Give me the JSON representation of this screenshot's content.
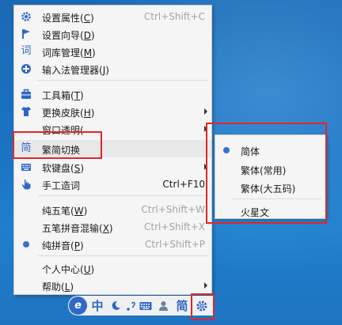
{
  "main_menu": {
    "items": [
      {
        "label": "设置属性(",
        "key": "C",
        "end": ")",
        "shortcut": "Ctrl+Shift+C",
        "icon": "gear-icon"
      },
      {
        "label": "设置向导(",
        "key": "D",
        "end": ")",
        "icon": "flag-icon"
      },
      {
        "label": "词库管理(",
        "key": "M",
        "end": ")",
        "icon": "dictionary-icon",
        "icon_text": "词"
      },
      {
        "label": "输入法管理器(",
        "key": "J",
        "end": ")",
        "icon": "ime-manager-icon"
      },
      {
        "label": "工具箱(",
        "key": "T",
        "end": ")",
        "icon": "toolbox-icon"
      },
      {
        "label": "更换皮肤(",
        "key": "H",
        "end": ")",
        "icon": "shirt-icon"
      },
      {
        "label": "窗口透明(",
        "key": "",
        "end": "",
        "icon": "transparency-icon"
      },
      {
        "label": "繁简切换",
        "key": "",
        "end": "",
        "icon": "simplified-traditional-icon",
        "icon_text": "简"
      },
      {
        "label": "软键盘(",
        "key": "S",
        "end": ")",
        "icon": "keyboard-icon"
      },
      {
        "label": "手工造词",
        "key": "",
        "end": "",
        "shortcut": "Ctrl+F10",
        "icon": "hand-icon"
      },
      {
        "label": "纯五笔(",
        "key": "W",
        "end": ")",
        "shortcut": "Ctrl+Shift+W"
      },
      {
        "label": "五笔拼音混输(",
        "key": "X",
        "end": ")",
        "shortcut": "Ctrl+Shift+X"
      },
      {
        "label": "纯拼音(",
        "key": "P",
        "end": ")",
        "shortcut": "Ctrl+Shift+P",
        "icon": "radio-dot-icon"
      },
      {
        "label": "个人中心(",
        "key": "U",
        "end": ")"
      },
      {
        "label": "帮助(",
        "key": "L",
        "end": ")"
      }
    ]
  },
  "sub_menu": {
    "items": [
      {
        "label": "简体",
        "selected": true
      },
      {
        "label": "繁体(常用)"
      },
      {
        "label": "繁体(大五码)"
      },
      {
        "label": "火星文"
      }
    ]
  },
  "toolbar": {
    "logo": "e",
    "lang": "中",
    "simp": "简"
  },
  "colors": {
    "accent": "#2f66c9",
    "highlight_border": "#e0262a"
  }
}
